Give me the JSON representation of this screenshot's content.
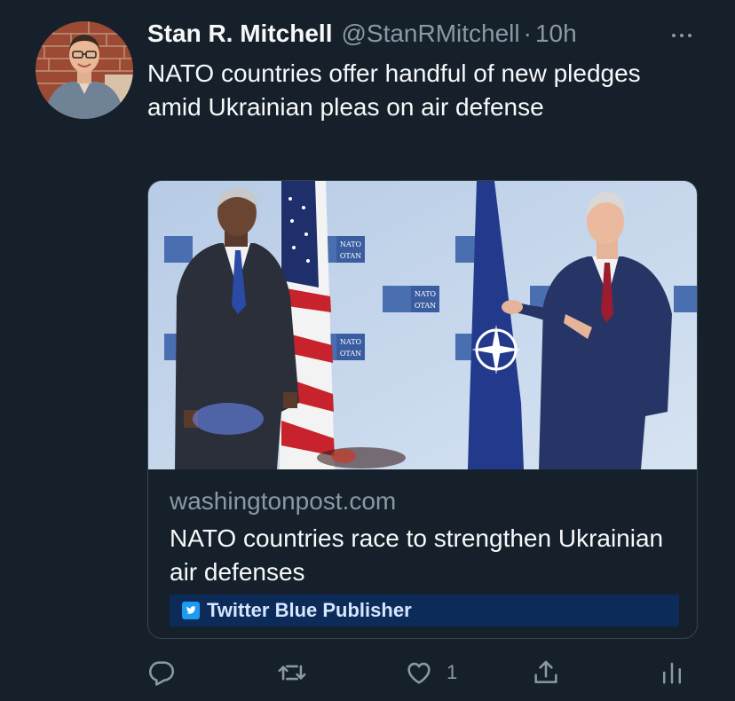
{
  "tweet": {
    "author_name": "Stan R. Mitchell",
    "author_handle": "@StanRMitchell",
    "separator": "·",
    "time": "10h",
    "text": "NATO countries offer handful of new pledges amid Ukrainian pleas on air defense"
  },
  "card": {
    "domain": "washingtonpost.com",
    "title": "NATO countries race to strengthen Ukrainian air defenses",
    "publisher_label": "Twitter Blue Publisher",
    "image_signs": [
      "NATO",
      "OTAN"
    ]
  },
  "actions": {
    "reply_icon": "reply-icon",
    "retweet_icon": "retweet-icon",
    "like_icon": "heart-icon",
    "like_count": "1",
    "share_icon": "share-icon",
    "analytics_icon": "analytics-icon"
  },
  "colors": {
    "background": "#15202b",
    "text_primary": "#f7f9f9",
    "text_secondary": "#8b98a5",
    "card_border": "#38444d",
    "publisher_bg": "#0d2b58",
    "twitter_blue": "#1d9bf0"
  }
}
